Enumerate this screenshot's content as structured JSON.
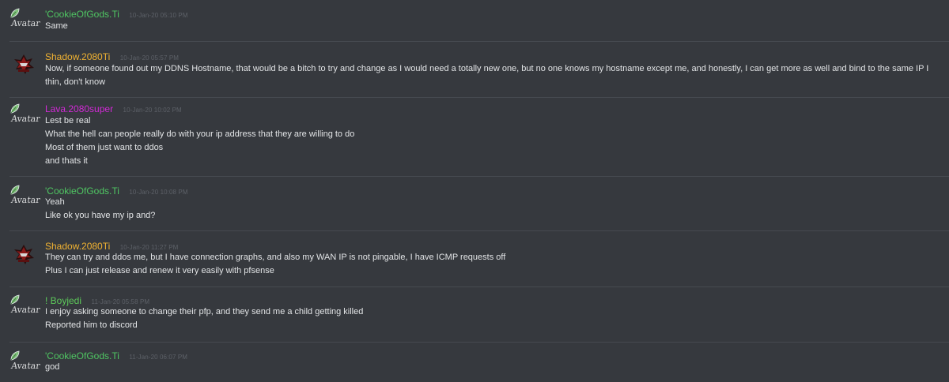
{
  "colors": {
    "background": "#36393e",
    "divider": "#464a50",
    "message_text": "#e2e4e6",
    "timestamp": "#5d6168",
    "cookie_green": "#4fc562",
    "shadow_yellow": "#f0b232",
    "lava_magenta": "#d22ad6",
    "boyjedi_green": "#5dc95a"
  },
  "messages": [
    {
      "author": "'CookieOfGods.Ti",
      "author_color": "#4fc562",
      "timestamp": "10-Jan-20 05:10 PM",
      "avatar": "broken-image-icon",
      "avatar_alt": "Avatar",
      "lines": [
        "Same"
      ]
    },
    {
      "author": "Shadow.2080Ti",
      "author_color": "#f0b232",
      "timestamp": "10-Jan-20 05:57 PM",
      "avatar": "shadow-avatar",
      "lines": [
        "Now, if someone found out my DDNS Hostname, that would be a bitch to try and change as I would need a totally new one, but no one knows my hostname except me, and honestly, I can get more as well and bind to the same IP I",
        "thin, don't know"
      ]
    },
    {
      "author": "Lava.2080super",
      "author_color": "#d22ad6",
      "timestamp": "10-Jan-20 10:02 PM",
      "avatar": "broken-image-icon",
      "avatar_alt": "Avatar",
      "lines": [
        "Lest be real",
        "What the hell can people really do with your ip address that they are willing to do",
        "Most of them just want to ddos",
        "and thats it"
      ]
    },
    {
      "author": "'CookieOfGods.Ti",
      "author_color": "#4fc562",
      "timestamp": "10-Jan-20 10:08 PM",
      "avatar": "broken-image-icon",
      "avatar_alt": "Avatar",
      "lines": [
        "Yeah",
        "Like ok you have my ip and?"
      ]
    },
    {
      "author": "Shadow.2080Ti",
      "author_color": "#f0b232",
      "timestamp": "10-Jan-20 11:27 PM",
      "avatar": "shadow-avatar",
      "lines": [
        "They can try and ddos me, but I have connection graphs, and also my WAN IP is not pingable, I have ICMP requests off",
        "Plus I can just release and renew it very easily with pfsense"
      ]
    },
    {
      "author": "! Boyjedi",
      "author_color": "#5dc95a",
      "timestamp": "11-Jan-20 05:58 PM",
      "avatar": "broken-image-icon",
      "avatar_alt": "Avatar",
      "lines": [
        "I enjoy asking someone to change their pfp, and they send me a child getting killed",
        "Reported him to discord"
      ]
    },
    {
      "author": "'CookieOfGods.Ti",
      "author_color": "#4fc562",
      "timestamp": "11-Jan-20 06:07 PM",
      "avatar": "broken-image-icon",
      "avatar_alt": "Avatar",
      "lines": [
        "god"
      ]
    }
  ]
}
